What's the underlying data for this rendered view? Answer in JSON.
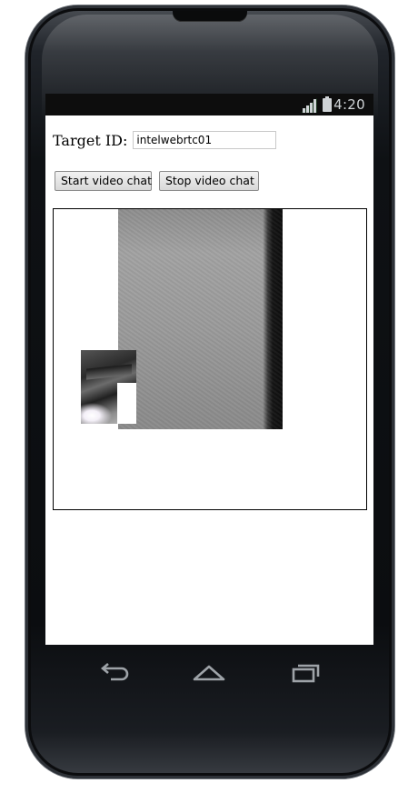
{
  "status_bar": {
    "time": "4:20",
    "icons": [
      "signal-icon",
      "battery-icon"
    ]
  },
  "form": {
    "target_label": "Target ID:",
    "target_value": "intelwebrtc01"
  },
  "buttons": {
    "start_label": "Start video chat",
    "stop_label": "Stop video chat"
  },
  "nav_bar": {
    "icons": [
      "back-icon",
      "home-icon",
      "recent-apps-icon"
    ]
  }
}
